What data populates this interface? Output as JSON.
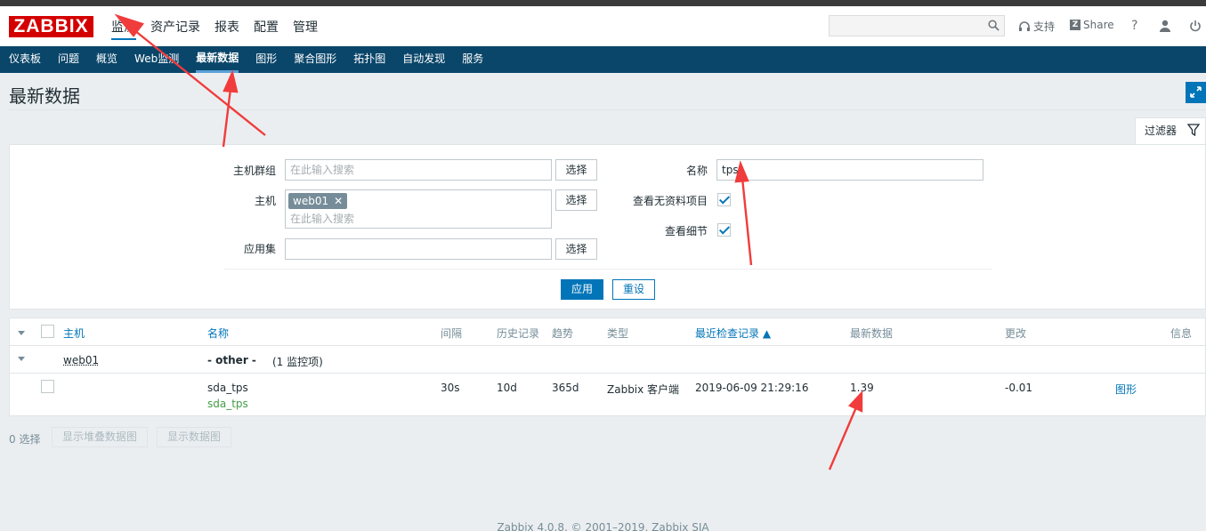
{
  "header": {
    "logo": "ZABBIX",
    "menu": [
      "监测",
      "资产记录",
      "报表",
      "配置",
      "管理"
    ],
    "support": "支持",
    "share": "Share",
    "help": "?",
    "search": {
      "placeholder": ""
    }
  },
  "subnav": [
    "仪表板",
    "问题",
    "概览",
    "Web监测",
    "最新数据",
    "图形",
    "聚合图形",
    "拓扑图",
    "自动发现",
    "服务"
  ],
  "page": {
    "title": "最新数据"
  },
  "filter": {
    "tab_label": "过滤器",
    "hostgroup_label": "主机群组",
    "hostgroup_placeholder": "在此输入搜索",
    "host_label": "主机",
    "host_tag": "web01",
    "host_placeholder": "在此输入搜索",
    "application_label": "应用集",
    "select_label": "选择",
    "name_label": "名称",
    "name_value": "tps",
    "show_without_data_label": "查看无资料项目",
    "show_details_label": "查看细节",
    "apply_label": "应用",
    "reset_label": "重设"
  },
  "table": {
    "headers": {
      "host": "主机",
      "name": "名称",
      "interval": "间隔",
      "history": "历史记录",
      "trends": "趋势",
      "type": "类型",
      "last_check": "最近检查记录 ▲",
      "last_value": "最新数据",
      "change": "更改",
      "info": "信息"
    },
    "group_row": {
      "host": "web01",
      "app_name": "- other -",
      "app_count": "(1 监控项)"
    },
    "item_row": {
      "name": "sda_tps",
      "key": "sda_tps",
      "interval": "30s",
      "history": "10d",
      "trends": "365d",
      "type": "Zabbix 客户端",
      "last_check": "2019-06-09 21:29:16",
      "last_value": "1.39",
      "change": "-0.01",
      "graph": "图形"
    }
  },
  "bottom": {
    "selected": "0 选择",
    "stacked_graph": "显示堆叠数据图",
    "graph": "显示数据图"
  },
  "footer": {
    "copyright": "Zabbix 4.0.8. © 2001–2019, Zabbix SIA"
  },
  "colors": {
    "accent": "#0275b8",
    "subnav": "#0a466a",
    "logo": "#d40000",
    "annotation_arrow": "#f03c3c"
  }
}
